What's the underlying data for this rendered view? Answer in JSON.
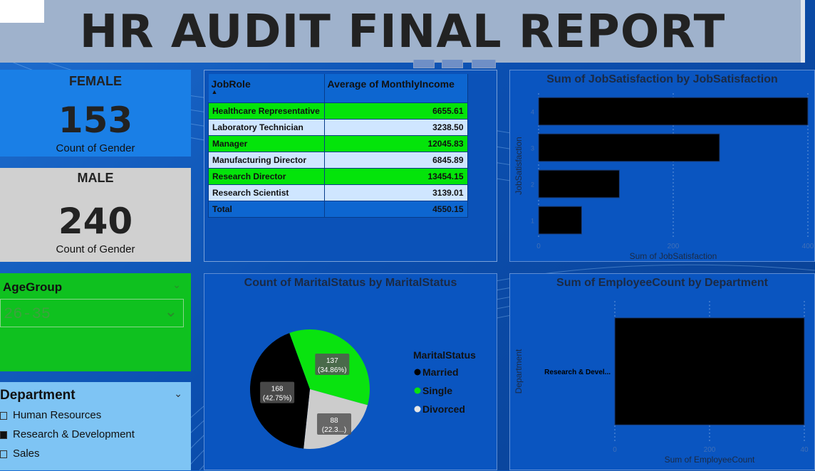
{
  "title": "HR AUDIT FINAL REPORT",
  "cards": {
    "female": {
      "title": "FEMALE",
      "value": "153",
      "sub": "Count of Gender"
    },
    "male": {
      "title": "MALE",
      "value": "240",
      "sub": "Count of Gender"
    }
  },
  "age_slicer": {
    "label": "AgeGroup",
    "value": "26-35"
  },
  "dept_slicer": {
    "label": "Department",
    "items": [
      {
        "label": "Human Resources",
        "checked": false
      },
      {
        "label": "Research & Development",
        "checked": true
      },
      {
        "label": "Sales",
        "checked": false
      }
    ]
  },
  "job_table": {
    "headers": [
      "JobRole",
      "Average of MonthlyIncome"
    ],
    "rows": [
      [
        "Healthcare Representative",
        "6655.61"
      ],
      [
        "Laboratory Technician",
        "3238.50"
      ],
      [
        "Manager",
        "12045.83"
      ],
      [
        "Manufacturing Director",
        "6845.89"
      ],
      [
        "Research Director",
        "13454.15"
      ],
      [
        "Research Scientist",
        "3139.01"
      ]
    ],
    "total": [
      "Total",
      "4550.15"
    ]
  },
  "chart_data": [
    {
      "type": "bar",
      "orientation": "horizontal",
      "title": "Sum of JobSatisfaction by JobSatisfaction",
      "xlabel": "Sum of JobSatisfaction",
      "ylabel": "JobSatisfaction",
      "categories": [
        "4",
        "3",
        "2",
        "1"
      ],
      "values": [
        500,
        336,
        150,
        80
      ],
      "xlim": [
        0,
        500
      ],
      "xticks": [
        "0",
        "200",
        "400"
      ],
      "bar_color": "#000000"
    },
    {
      "type": "pie",
      "title": "Count of MaritalStatus by MaritalStatus",
      "legend_title": "MaritalStatus",
      "slices": [
        {
          "label": "Married",
          "value": 168,
          "pct": "42.75%",
          "text": "168",
          "subtext": "(42.75%)",
          "color": "#000000"
        },
        {
          "label": "Single",
          "value": 137,
          "pct": "34.86%",
          "text": "137",
          "subtext": "(34.86%)",
          "color": "#09e30f"
        },
        {
          "label": "Divorced",
          "value": 88,
          "pct": "22.39%",
          "text": "88",
          "subtext": "(22.3...)",
          "color": "#cccccc"
        }
      ]
    },
    {
      "type": "bar",
      "orientation": "horizontal",
      "title": "Sum of EmployeeCount by Department",
      "xlabel": "Sum of EmployeeCount",
      "ylabel": "Department",
      "categories": [
        "Research & Devel..."
      ],
      "values": [
        400
      ],
      "xlim": [
        0,
        400
      ],
      "xticks": [
        "0",
        "200",
        "40"
      ],
      "bar_color": "#000000"
    }
  ]
}
